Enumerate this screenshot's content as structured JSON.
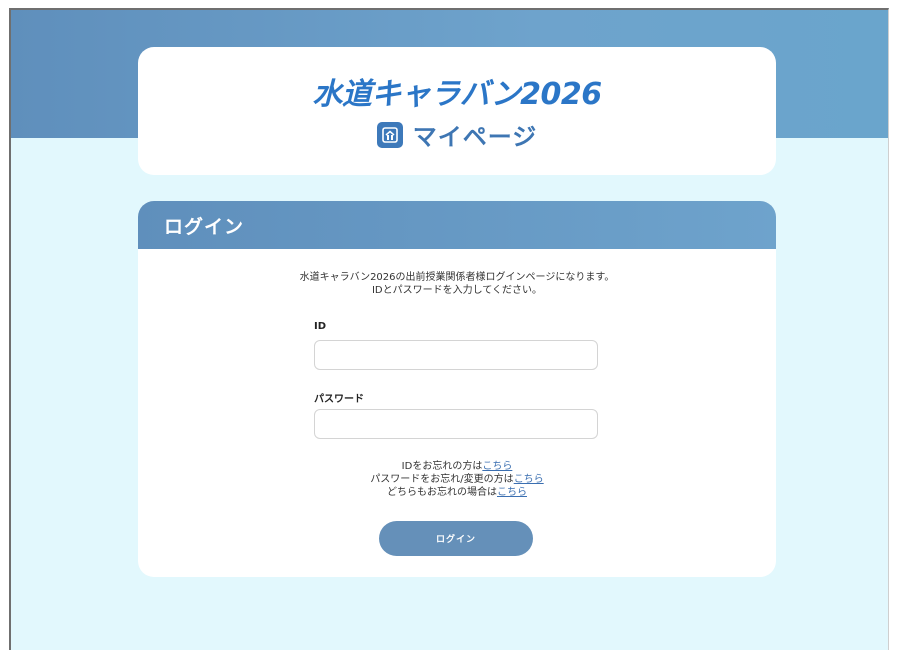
{
  "header": {
    "logo_text": "水道キャラバン2026",
    "mypage_label": "マイページ",
    "mypage_icon": "building-icon"
  },
  "login": {
    "title": "ログイン",
    "intro_line1": "水道キャラバン2026の出前授業関係者様ログインページになります。",
    "intro_line2": "IDとパスワードを入力してください。",
    "id_label": "ID",
    "id_value": "",
    "password_label": "パスワード",
    "password_value": "",
    "forgot_id_text": "IDをお忘れの方は",
    "forgot_password_text": "パスワードをお忘れ/変更の方は",
    "forgot_both_text": "どちらもお忘れの場合は",
    "link_text": "こちら",
    "submit_label": "ログイン"
  },
  "colors": {
    "accent": "#6590b9",
    "band": "#6aa5cc",
    "background": "#e2f8fd",
    "logo": "#2b76c7"
  }
}
